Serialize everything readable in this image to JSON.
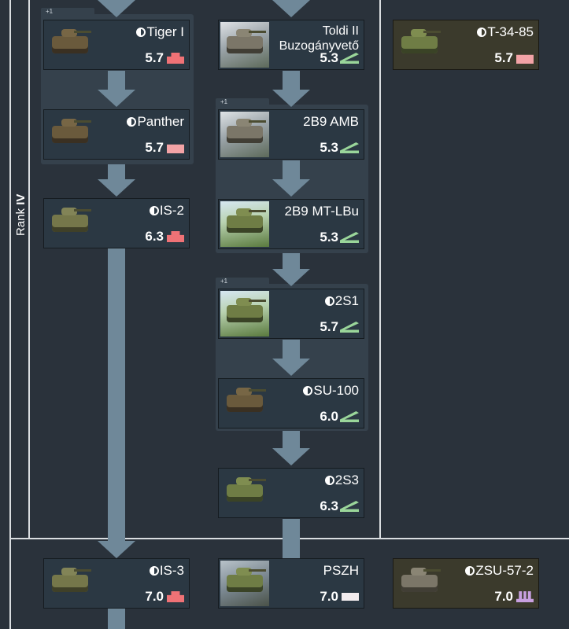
{
  "rank": {
    "label_prefix": "Rank",
    "label_value": "IV"
  },
  "groups": [
    {
      "badge": "+1"
    },
    {
      "badge": "+1"
    },
    {
      "badge": "+1"
    }
  ],
  "vehicles": [
    {
      "id": "tiger1",
      "name": "Tiger I",
      "half_icon": true,
      "br": "5.7",
      "role": "heavy",
      "thumb": "tank",
      "tone": "brown",
      "premium": false
    },
    {
      "id": "panther",
      "name": "Panther",
      "half_icon": true,
      "br": "5.7",
      "role": "medium",
      "thumb": "tank",
      "tone": "brown",
      "premium": false
    },
    {
      "id": "is2",
      "name": "IS-2",
      "half_icon": true,
      "br": "6.3",
      "role": "heavy",
      "thumb": "tank",
      "tone": "olive",
      "premium": false
    },
    {
      "id": "toldi",
      "name_lines": [
        "Toldi II",
        "Buzogányvető"
      ],
      "half_icon": false,
      "br": "5.3",
      "role": "td",
      "thumb": "photo",
      "premium": false
    },
    {
      "id": "2b9amb",
      "name": "2B9 AMB",
      "half_icon": false,
      "br": "5.3",
      "role": "td",
      "thumb": "photo",
      "premium": false
    },
    {
      "id": "2b9mtlbu",
      "name": "2B9 MT-LBu",
      "half_icon": false,
      "br": "5.3",
      "role": "td",
      "thumb": "photo-green",
      "premium": false
    },
    {
      "id": "2s1",
      "name": "2S1",
      "half_icon": true,
      "br": "5.7",
      "role": "td",
      "thumb": "photo-green",
      "premium": false
    },
    {
      "id": "su100",
      "name": "SU-100",
      "half_icon": true,
      "br": "6.0",
      "role": "td",
      "thumb": "tank",
      "tone": "brown",
      "premium": false
    },
    {
      "id": "2s3",
      "name": "2S3",
      "half_icon": true,
      "br": "6.3",
      "role": "td",
      "thumb": "tank",
      "tone": "green",
      "premium": false
    },
    {
      "id": "t3485",
      "name": "T-34-85",
      "half_icon": true,
      "br": "5.7",
      "role": "medium",
      "thumb": "tank",
      "tone": "green",
      "premium": true
    },
    {
      "id": "is3",
      "name": "IS-3",
      "half_icon": true,
      "br": "7.0",
      "role": "heavy",
      "thumb": "tank",
      "tone": "olive",
      "premium": false
    },
    {
      "id": "pszh",
      "name": "PSZH",
      "half_icon": false,
      "br": "7.0",
      "role": "light",
      "thumb": "photo-street",
      "premium": false
    },
    {
      "id": "zsu572",
      "name": "ZSU-57-2",
      "half_icon": true,
      "br": "7.0",
      "role": "spaa",
      "thumb": "tank",
      "tone": "grey",
      "premium": true
    }
  ],
  "colors": {
    "background": "#2a323b",
    "card": "#2b3843",
    "premium_card": "#3b3a2c",
    "connector": "#6f8899",
    "heavy": "#ef7276",
    "medium": "#f3a3a6",
    "tank_destroyer": "#9ad69a",
    "spaa": "#c8a0e0",
    "light": "#f2ecee"
  }
}
